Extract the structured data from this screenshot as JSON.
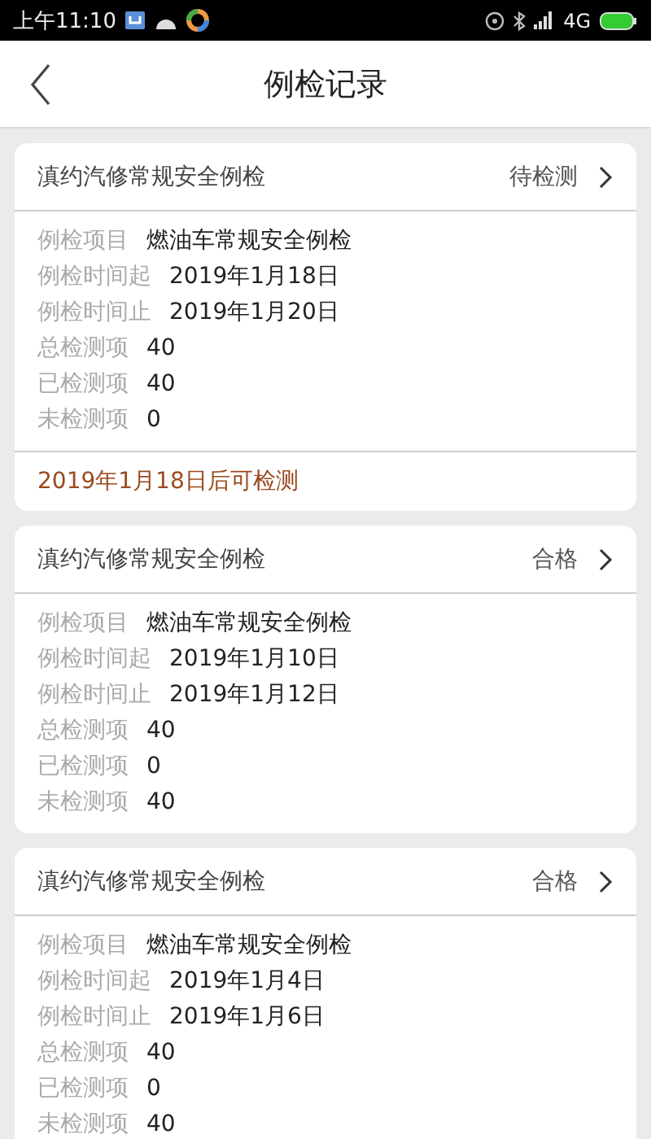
{
  "status_bar": {
    "time": "上午11:10",
    "network": "4G"
  },
  "header": {
    "title": "例检记录"
  },
  "records": [
    {
      "title": "滇约汽修常规安全例检",
      "status": "待检测",
      "fields": [
        {
          "label": "例检项目",
          "value": "燃油车常规安全例检"
        },
        {
          "label": "例检时间起",
          "value": "2019年1月18日"
        },
        {
          "label": "例检时间止",
          "value": "2019年1月20日"
        },
        {
          "label": "总检测项",
          "value": "40"
        },
        {
          "label": "已检测项",
          "value": "40"
        },
        {
          "label": "未检测项",
          "value": "0"
        }
      ],
      "note": "2019年1月18日后可检测"
    },
    {
      "title": "滇约汽修常规安全例检",
      "status": "合格",
      "fields": [
        {
          "label": "例检项目",
          "value": "燃油车常规安全例检"
        },
        {
          "label": "例检时间起",
          "value": "2019年1月10日"
        },
        {
          "label": "例检时间止",
          "value": "2019年1月12日"
        },
        {
          "label": "总检测项",
          "value": "40"
        },
        {
          "label": "已检测项",
          "value": "0"
        },
        {
          "label": "未检测项",
          "value": "40"
        }
      ]
    },
    {
      "title": "滇约汽修常规安全例检",
      "status": "合格",
      "fields": [
        {
          "label": "例检项目",
          "value": "燃油车常规安全例检"
        },
        {
          "label": "例检时间起",
          "value": "2019年1月4日"
        },
        {
          "label": "例检时间止",
          "value": "2019年1月6日"
        },
        {
          "label": "总检测项",
          "value": "40"
        },
        {
          "label": "已检测项",
          "value": "0"
        },
        {
          "label": "未检测项",
          "value": "40"
        }
      ]
    }
  ]
}
